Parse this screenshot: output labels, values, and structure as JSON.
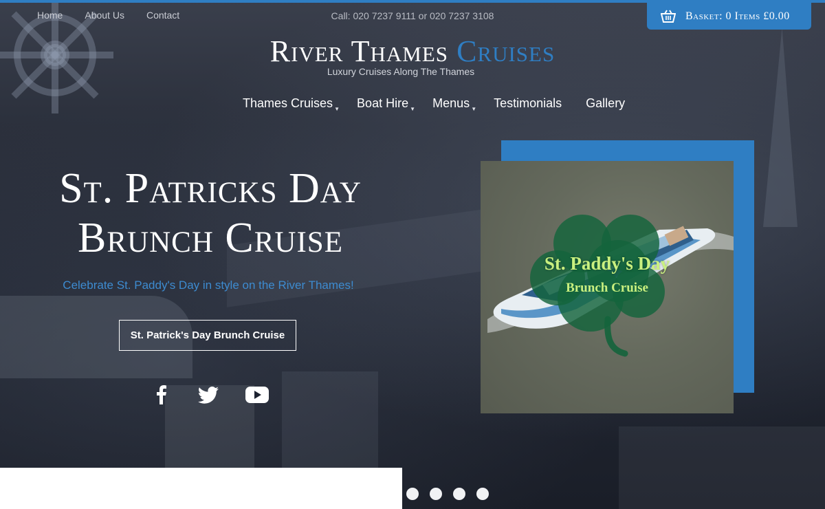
{
  "topnav": {
    "links": [
      "Home",
      "About Us",
      "Contact"
    ]
  },
  "phone": "Call: 020 7237 9111 or 020 7237 3108",
  "basket": {
    "label": "Basket: 0 Items £0.00",
    "icon": "basket-icon"
  },
  "logo": {
    "part1": "River Thames",
    "part2": "Cruises",
    "tagline": "Luxury Cruises Along The Thames"
  },
  "mainnav": {
    "items": [
      "Thames Cruises",
      "Boat Hire",
      "Menus",
      "Testimonials",
      "Gallery"
    ]
  },
  "hero": {
    "headline_line1": "St. Patricks Day",
    "headline_line2": "Brunch Cruise",
    "subline": "Celebrate St. Paddy's Day in style on the River Thames!",
    "cta_label": "St. Patrick's Day Brunch Cruise",
    "social_icons": [
      "facebook-icon",
      "twitter-icon",
      "youtube-icon"
    ]
  },
  "promo": {
    "title": "St. Paddy's Day",
    "subtitle": "Brunch Cruise"
  },
  "slider": {
    "dot_count": 4
  },
  "colors": {
    "accent": "#2f7ec3",
    "promo_text": "#c9f07f",
    "subline": "#3d8bd0"
  }
}
